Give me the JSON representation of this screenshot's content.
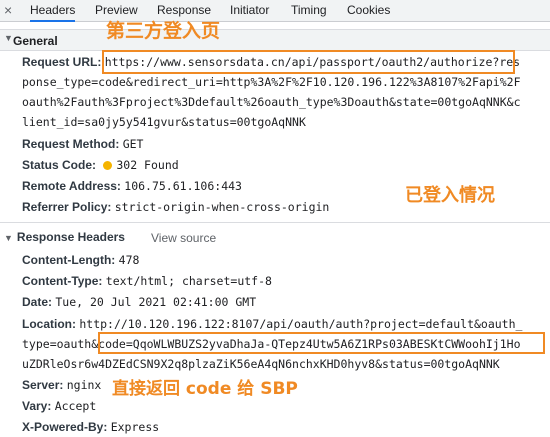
{
  "tabs": {
    "close_glyph": "×",
    "items": [
      "Headers",
      "Preview",
      "Response",
      "Initiator",
      "Timing",
      "Cookies"
    ]
  },
  "general": {
    "title": "General",
    "request_url_key": "Request URL:",
    "request_url_lines": [
      "https://www.sensorsdata.cn/api/passport/oauth2/authorize?res",
      "ponse_type=code&redirect_uri=http%3A%2F%2F10.120.196.122%3A8107%2Fapi%2F",
      "oauth%2Fauth%3Fproject%3Ddefault%26oauth_type%3Doauth&state=00tgoAqNNK&c",
      "lient_id=sa0jy5y541gvur&status=00tgoAqNNK"
    ],
    "request_method_key": "Request Method:",
    "request_method": "GET",
    "status_code_key": "Status Code:",
    "status_code": "302 Found",
    "remote_address_key": "Remote Address:",
    "remote_address": "106.75.61.106:443",
    "referrer_policy_key": "Referrer Policy:",
    "referrer_policy": "strict-origin-when-cross-origin"
  },
  "response_headers": {
    "title": "Response Headers",
    "view_source": "View source",
    "content_length_key": "Content-Length:",
    "content_length": "478",
    "content_type_key": "Content-Type:",
    "content_type": "text/html; charset=utf-8",
    "date_key": "Date:",
    "date": "Tue, 20 Jul 2021 02:41:00 GMT",
    "location_key": "Location:",
    "location_lines": [
      "http://10.120.196.122:8107/api/oauth/auth?project=default&oauth_",
      "type=oauth&code=QqoWLWBUZS2yvaDhaJa-QTepz4Utw5A6Z1RPs03ABESKtCWWoohIj1Ho",
      "uZDRleOsr6w4DZEdCSN9X2q8plzaZiK56eA4qN6nchxKHD0hyv8&status=00tgoAqNNK"
    ],
    "server_key": "Server:",
    "server": "nginx",
    "vary_key": "Vary:",
    "vary": "Accept",
    "x_powered_by_key": "X-Powered-By:",
    "x_powered_by": "Express"
  },
  "annotations": {
    "third_party_page": "第三方登入页",
    "logged_in": "已登入情况",
    "return_code": "直接返回 code 给 SBP",
    "color": "#f08a24"
  }
}
